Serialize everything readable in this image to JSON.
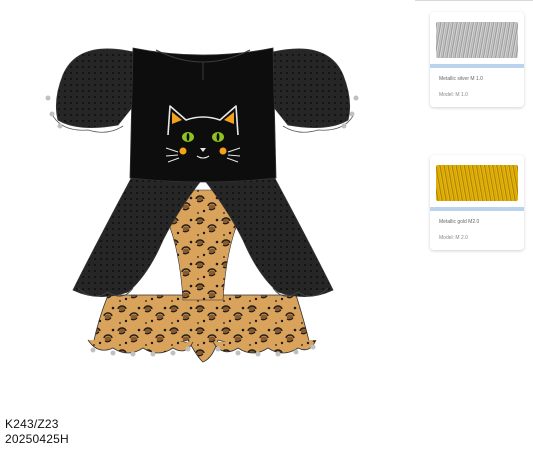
{
  "swatches": [
    {
      "name": "Metallic silver M 1.0",
      "model": "Model: M 1.0",
      "color": "#b5b5b5"
    },
    {
      "name": "Metallic gold M2.0",
      "model": "Model: M 2.0",
      "color": "#e0ad0a"
    }
  ],
  "style_code": "K243/Z23",
  "date_code": "20250425H",
  "colors": {
    "bodice": "#0d0d0d",
    "sleeve": "#1e1e1e",
    "leopard_base": "#d9a35c",
    "leopard_spot": "#1a1a1a",
    "pompom": "#c0c0c0",
    "cat_eyes": "#8fc31f",
    "cat_ears": "#f4a21c"
  },
  "icons": [
    "cat-face-icon"
  ]
}
